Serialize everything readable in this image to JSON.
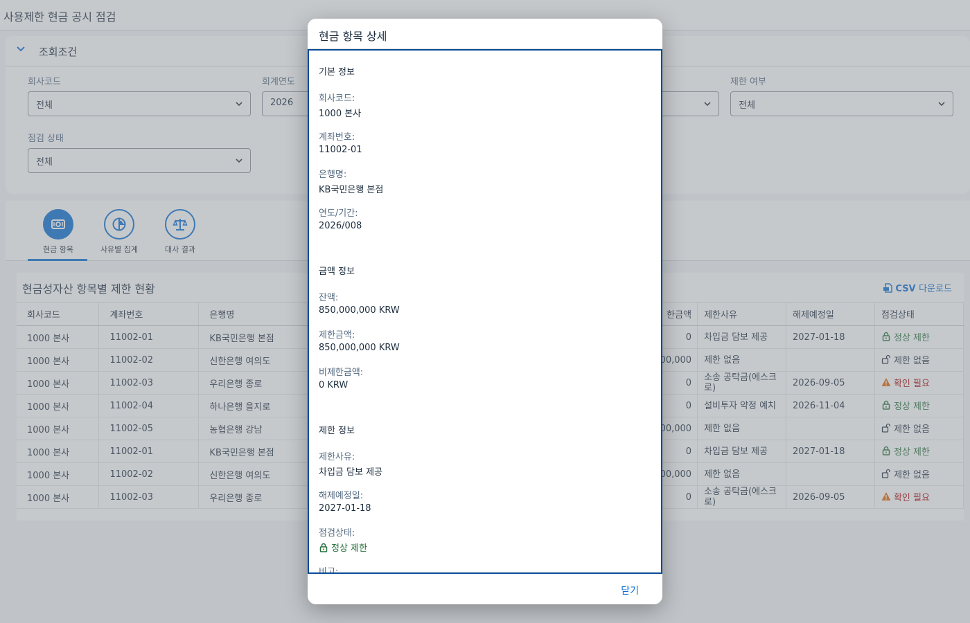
{
  "page": {
    "title": "사용제한 현금 공시 점검"
  },
  "filter": {
    "title": "조회조건",
    "fields": {
      "company": {
        "label": "회사코드",
        "value": "전체"
      },
      "fiscal_year": {
        "label": "회계연도",
        "value": "2026"
      },
      "restricted": {
        "label": "제한 여부",
        "value": "전체"
      },
      "check_status": {
        "label": "점검 상태",
        "value": "전체"
      }
    }
  },
  "tabs": [
    {
      "label": "현금 항목",
      "icon": "cash-icon",
      "active": true
    },
    {
      "label": "사유별 집계",
      "icon": "pie-chart-icon",
      "active": false
    },
    {
      "label": "대사 결과",
      "icon": "balance-scale-icon",
      "active": false
    }
  ],
  "table": {
    "title": "현금성자산 항목별 제한 현황",
    "csv_label": "CSV",
    "csv_tail": "다운로드",
    "columns": {
      "company": "회사코드",
      "account": "계좌번호",
      "bank": "은행명",
      "restricted_amount": "한금액",
      "reason": "제한사유",
      "release_date": "해제예정일",
      "status": "점검상태"
    },
    "rows": [
      {
        "company": "1000 본사",
        "account": "11002-01",
        "bank": "KB국민은행 본점",
        "amount": "0",
        "reason": "차입금 담보 제공",
        "release": "2027-01-18",
        "status": "정상 제한",
        "status_type": "normal"
      },
      {
        "company": "1000 본사",
        "account": "11002-02",
        "bank": "신한은행 여의도",
        "amount": "00,000",
        "reason": "제한 없음",
        "release": "",
        "status": "제한 없음",
        "status_type": "none"
      },
      {
        "company": "1000 본사",
        "account": "11002-03",
        "bank": "우리은행 종로",
        "amount": "0",
        "reason": "소송 공탁금(에스크로)",
        "release": "2026-09-05",
        "status": "확인 필요",
        "status_type": "check"
      },
      {
        "company": "1000 본사",
        "account": "11002-04",
        "bank": "하나은행 을지로",
        "amount": "0",
        "reason": "설비투자 약정 예치",
        "release": "2026-11-04",
        "status": "정상 제한",
        "status_type": "normal"
      },
      {
        "company": "1000 본사",
        "account": "11002-05",
        "bank": "농협은행 강남",
        "amount": "00,000",
        "reason": "제한 없음",
        "release": "",
        "status": "제한 없음",
        "status_type": "none"
      },
      {
        "company": "1000 본사",
        "account": "11002-01",
        "bank": "KB국민은행 본점",
        "amount": "0",
        "reason": "차입금 담보 제공",
        "release": "2027-01-18",
        "status": "정상 제한",
        "status_type": "normal"
      },
      {
        "company": "1000 본사",
        "account": "11002-02",
        "bank": "신한은행 여의도",
        "amount": "00,000",
        "reason": "제한 없음",
        "release": "",
        "status": "제한 없음",
        "status_type": "none"
      },
      {
        "company": "1000 본사",
        "account": "11002-03",
        "bank": "우리은행 종로",
        "amount": "0",
        "reason": "소송 공탁금(에스크로)",
        "release": "2026-09-05",
        "status": "확인 필요",
        "status_type": "check"
      }
    ]
  },
  "dialog": {
    "title": "현금 항목 상세",
    "basic": {
      "section": "기본 정보",
      "company_label": "회사코드:",
      "company": "1000 본사",
      "account_label": "계좌번호:",
      "account": "11002-01",
      "bank_label": "은행명:",
      "bank": "KB국민은행 본점",
      "period_label": "연도/기간:",
      "period": "2026/008"
    },
    "amount": {
      "section": "금액 정보",
      "balance_label": "잔액:",
      "balance": "850,000,000 KRW",
      "restricted_label": "제한금액:",
      "restricted": "850,000,000 KRW",
      "unrestricted_label": "비제한금액:",
      "unrestricted": "0 KRW"
    },
    "restriction": {
      "section": "제한 정보",
      "reason_label": "제한사유:",
      "reason": "차입금 담보 제공",
      "release_label": "해제예정일:",
      "release": "2027-01-18",
      "status_label": "점검상태:",
      "status": "정상 제한",
      "note_label": "비고:"
    },
    "close_label": "닫기"
  },
  "colors": {
    "accent": "#0a6ed1",
    "positive": "#256f3a",
    "critical": "#aa0808",
    "warning_icon": "#e76500"
  }
}
